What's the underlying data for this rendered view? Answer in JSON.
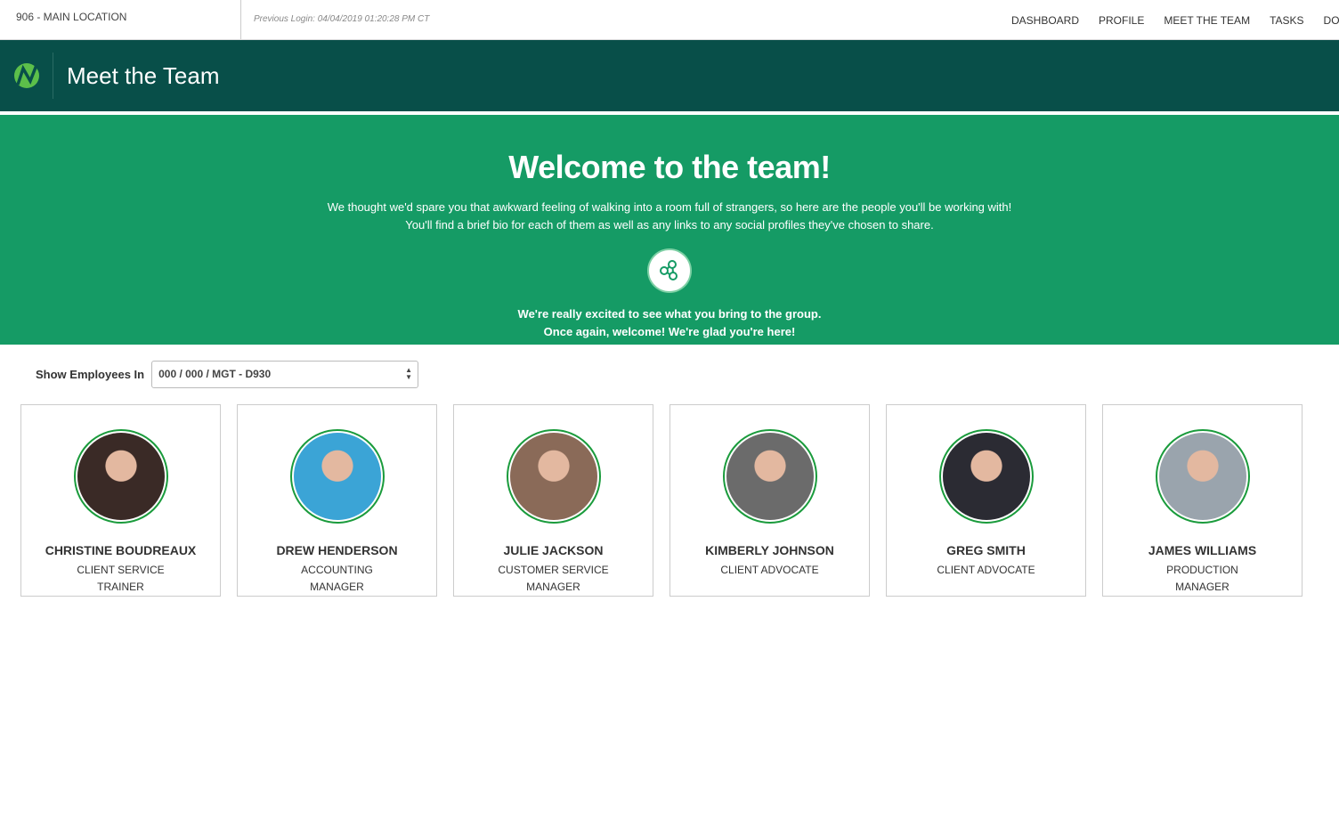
{
  "topbar": {
    "location": "906 - MAIN LOCATION",
    "previous_login": "Previous Login: 04/04/2019 01:20:28 PM CT",
    "nav": [
      "DASHBOARD",
      "PROFILE",
      "MEET THE TEAM",
      "TASKS",
      "DOCUMENTS"
    ]
  },
  "header": {
    "title": "Meet the Team"
  },
  "banner": {
    "heading": "Welcome to the team!",
    "line1": "We thought we'd spare you that awkward feeling of walking into a room full of strangers, so here are the people you'll be working with!",
    "line2": "You'll find a brief bio for each of them as well as any links to any social profiles they've chosen to share.",
    "line3": "We're really excited to see what you bring to the group.",
    "line4": "Once again, welcome! We're glad you're here!"
  },
  "filter": {
    "label": "Show Employees In",
    "value": "000 / 000 / MGT - D930"
  },
  "team": [
    {
      "name": "CHRISTINE BOUDREAUX",
      "role": "CLIENT SERVICE TRAINER",
      "color": "#3a2a26"
    },
    {
      "name": "DREW HENDERSON",
      "role": "ACCOUNTING MANAGER",
      "color": "#3ba4d6"
    },
    {
      "name": "JULIE JACKSON",
      "role": "CUSTOMER SERVICE MANAGER",
      "color": "#8a6a58"
    },
    {
      "name": "KIMBERLY JOHNSON",
      "role": "CLIENT ADVOCATE",
      "color": "#6b6b6b"
    },
    {
      "name": "GREG SMITH",
      "role": "CLIENT ADVOCATE",
      "color": "#2b2b33"
    },
    {
      "name": "JAMES WILLIAMS",
      "role": "PRODUCTION MANAGER",
      "color": "#9aa4ad"
    }
  ]
}
